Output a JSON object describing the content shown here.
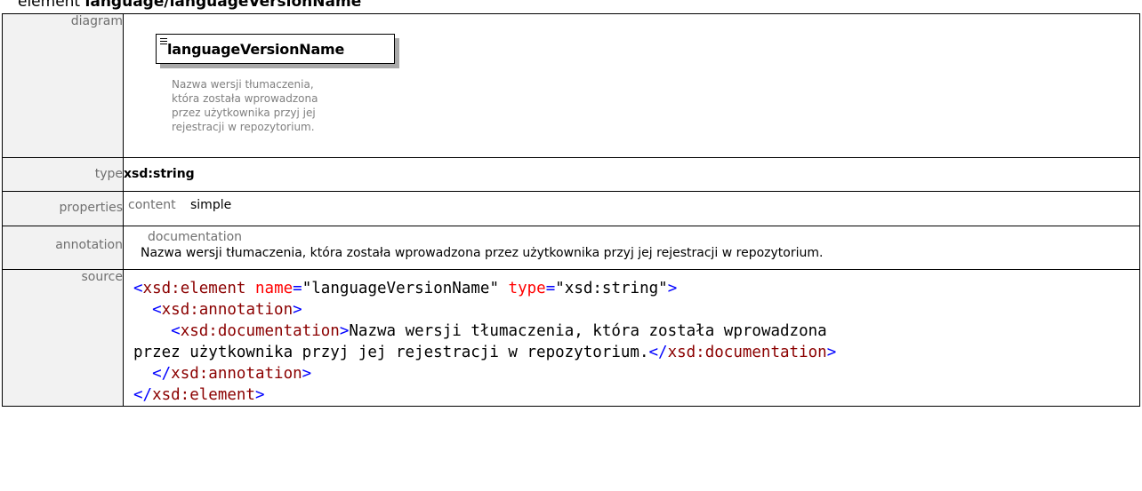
{
  "header": {
    "prefix": "element ",
    "name": "language/languageVersionName"
  },
  "labels": {
    "diagram": "diagram",
    "type": "type",
    "properties": "properties",
    "annotation": "annotation",
    "source": "source"
  },
  "diagram": {
    "element_name": "languageVersionName",
    "documentation_lines": [
      "Nazwa wersji tłumaczenia,",
      "która została wprowadzona",
      "przez użytkownika przyj jej",
      "rejestracji w repozytorium."
    ]
  },
  "type_value": "xsd:string",
  "properties": {
    "key": "content",
    "value": "simple"
  },
  "annotation": {
    "heading": "documentation",
    "text": "Nazwa wersji tłumaczenia, która została wprowadzona przez użytkownika przyj jej rejestracji w repozytorium."
  },
  "source": {
    "element_tag": "xsd:element",
    "attr_name": "name",
    "attr_name_value": "languageVersionName",
    "attr_type": "type",
    "attr_type_value": "xsd:string",
    "annotation_tag": "xsd:annotation",
    "documentation_tag": "xsd:documentation",
    "doc_line1": "Nazwa wersji tłumaczenia, która została wprowadzona",
    "doc_line2": "przez użytkownika przyj jej rejestracji w repozytorium."
  }
}
